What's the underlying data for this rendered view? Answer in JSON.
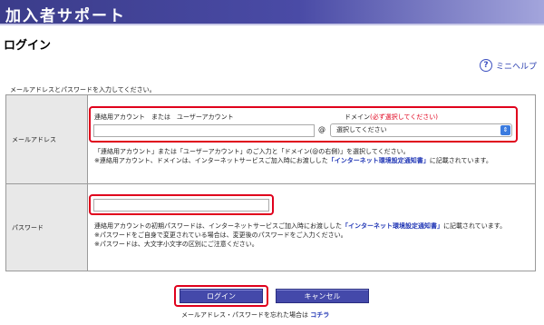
{
  "header": {
    "title": "加入者サポート"
  },
  "page_title": "ログイン",
  "help": {
    "icon": "question-circle-icon",
    "label": "ミニヘルプ"
  },
  "intro": "メールアドレスとパスワードを入力してください。",
  "email": {
    "label": "メールアドレス",
    "account_label": "連絡用アカウント　または　ユーザーアカウント",
    "account_value": "",
    "at": "@",
    "domain_label": "ドメイン",
    "domain_required": "(必ず選択してください)",
    "domain_selected": "選択してください",
    "note_line1": "「連絡用アカウント」または「ユーザーアカウント」のご入力と「ドメイン(@の右側)」を選択してください。",
    "note_line2a": "※連絡用アカウント、ドメインは、インターネットサービスご加入時にお渡しした",
    "note_link": "「インターネット環境設定通知書」",
    "note_line2b": "に記載されています。"
  },
  "password": {
    "label": "パスワード",
    "value": "",
    "note_a": "連絡用アカウントの初期パスワードは、インターネットサービスご加入時にお渡しした",
    "note_link": "「インターネット環境設定通知書」",
    "note_b": "に記載されています。",
    "note_line2": "※パスワードをご自身で変更されている場合は、変更後のパスワードをご入力ください。",
    "note_line3": "※パスワードは、大文字小文字の区別にご注意ください。"
  },
  "buttons": {
    "login": "ログイン",
    "cancel": "キャンセル"
  },
  "forgot": {
    "text": "メールアドレス・パスワードを忘れた場合は",
    "link": "コチラ"
  },
  "colors": {
    "header": "#4a4ba6",
    "highlight": "#e0001c",
    "button": "#4449aa",
    "link": "#1f35b5"
  }
}
